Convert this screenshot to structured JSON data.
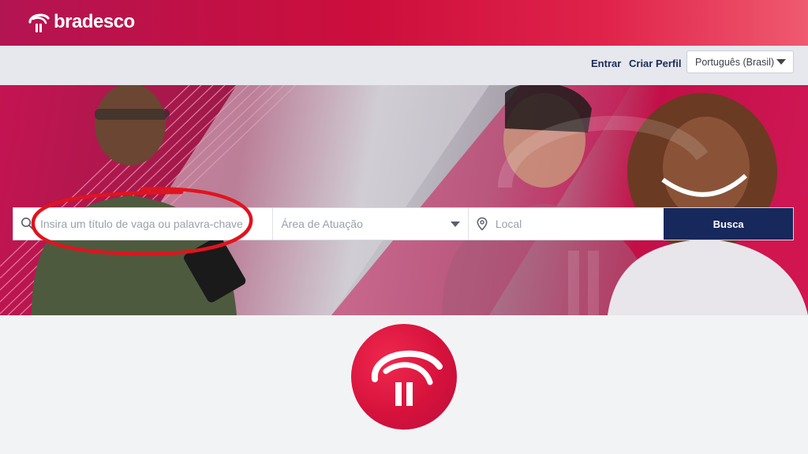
{
  "brand": {
    "name": "bradesco",
    "icon": "bradesco-tree-logo"
  },
  "nav": {
    "login_label": "Entrar",
    "create_profile_label": "Criar Perfil",
    "language": {
      "selected": "Português (Brasil)"
    }
  },
  "search": {
    "keyword_placeholder": "Insira um título de vaga ou palavra-chave",
    "area_placeholder": "Área de Atuação",
    "location_placeholder": "Local",
    "button_label": "Busca",
    "keyword_icon": "search-icon",
    "location_icon": "location-pin-icon"
  },
  "colors": {
    "brand_red": "#cc0e3c",
    "brand_magenta": "#b31452",
    "navy": "#17285c",
    "annotation_red": "#e0141e"
  }
}
